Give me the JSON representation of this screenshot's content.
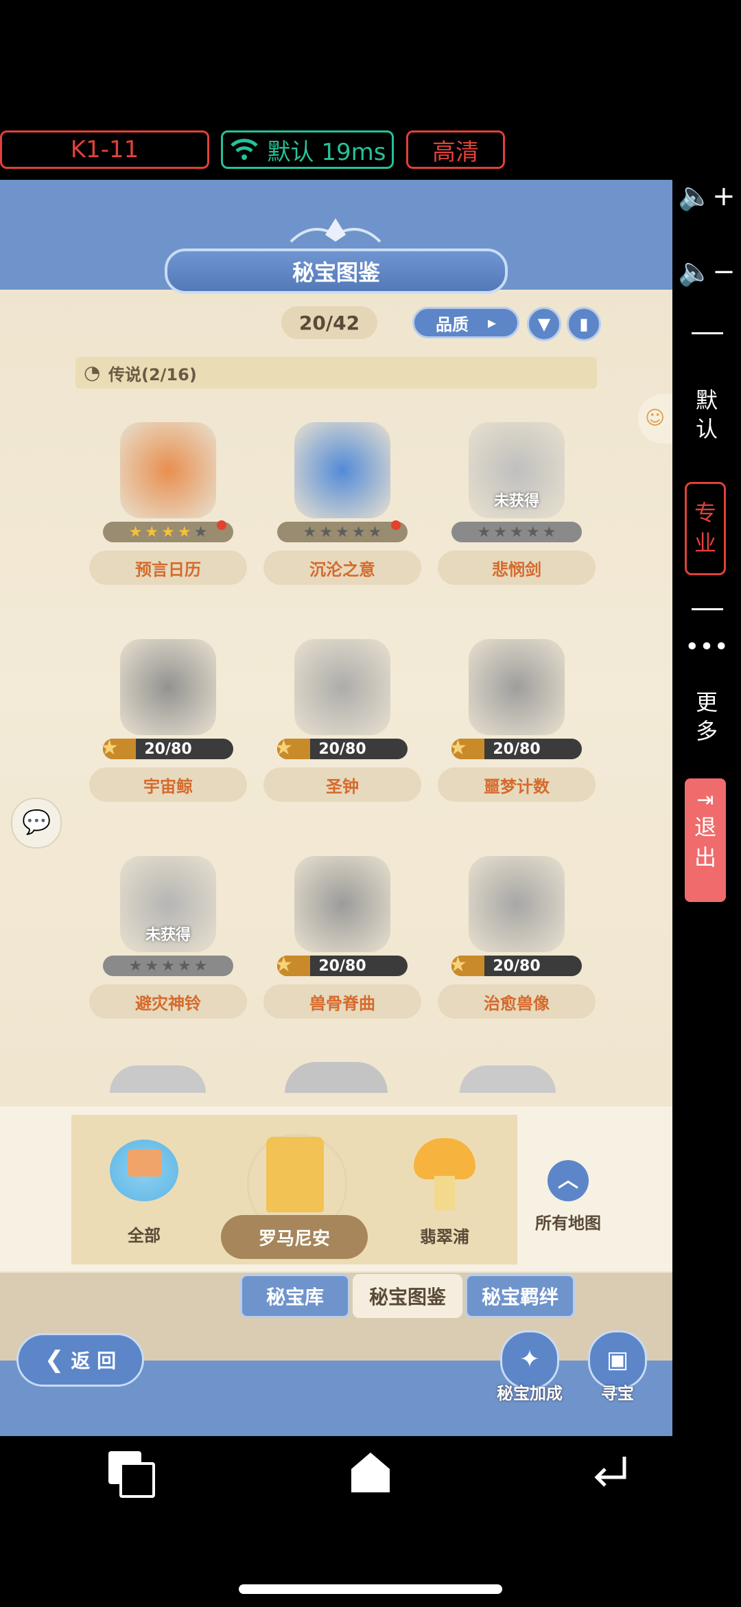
{
  "status_pills": {
    "level": "K1-11",
    "network": "默认 19ms",
    "quality": "高清"
  },
  "game": {
    "title": "秘宝图鉴",
    "count": "20/42",
    "quality_label": "品质",
    "section_label": "传说(2/16)",
    "items": [
      {
        "name": "预言日历",
        "state": "stars",
        "stars": 4,
        "dot": true
      },
      {
        "name": "沉沦之意",
        "state": "stars",
        "stars": 0,
        "dot": true
      },
      {
        "name": "悲悯剑",
        "state": "locked",
        "badge": "未获得"
      },
      {
        "name": "宇宙鲸",
        "state": "progress",
        "progress": "20/80",
        "fraction": 0.25
      },
      {
        "name": "圣钟",
        "state": "progress",
        "progress": "20/80",
        "fraction": 0.25
      },
      {
        "name": "噩梦计数",
        "state": "progress",
        "progress": "20/80",
        "fraction": 0.25
      },
      {
        "name": "避灾神铃",
        "state": "locked",
        "badge": "未获得"
      },
      {
        "name": "兽骨脊曲",
        "state": "progress",
        "progress": "20/80",
        "fraction": 0.25
      },
      {
        "name": "治愈兽像",
        "state": "progress",
        "progress": "20/80",
        "fraction": 0.25
      }
    ],
    "maps": {
      "all": "全部",
      "selected": "罗马尼安",
      "third": "翡翠浦",
      "all_maps": "所有地图"
    },
    "tabs": [
      "秘宝库",
      "秘宝图鉴",
      "秘宝羁绊"
    ],
    "back": "返 回",
    "bonus": "秘宝加成",
    "seek": "寻宝"
  },
  "side_panel": {
    "default": "默\n认",
    "pro": "专\n业",
    "more": "更\n多",
    "exit": "退\n出"
  },
  "colors": {
    "accent_red": "#e0413a",
    "accent_green": "#25c29a",
    "panel_blue": "#6f94cc"
  }
}
